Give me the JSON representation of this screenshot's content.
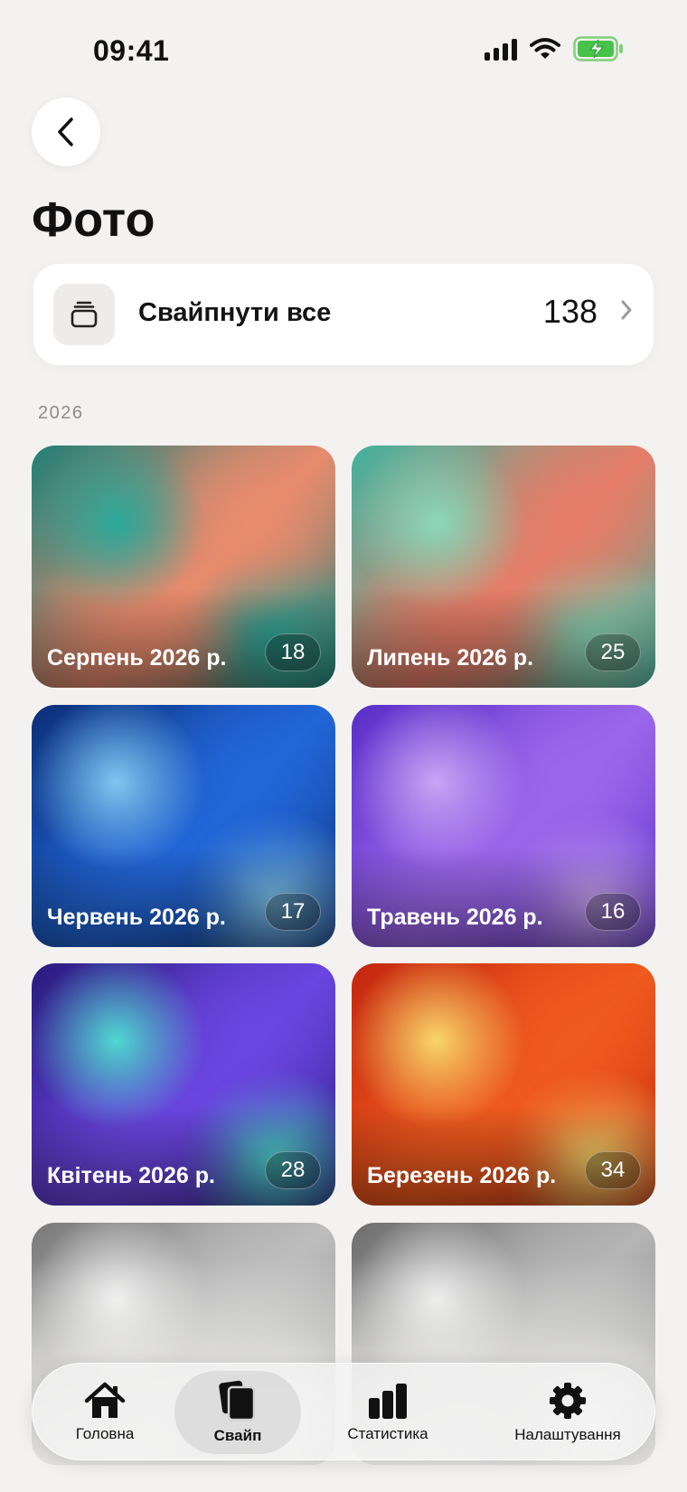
{
  "status_bar": {
    "time": "09:41"
  },
  "header": {
    "title": "Фото"
  },
  "swipe_all": {
    "label": "Свайпнути все",
    "count": "138"
  },
  "sections": [
    {
      "year": "2026",
      "months": [
        {
          "label": "Серпень 2026 р.",
          "count": "18",
          "palette": [
            "#1f7f78",
            "#e98b6d",
            "#2aa99a"
          ]
        },
        {
          "label": "Липень 2026 р.",
          "count": "25",
          "palette": [
            "#3fb3a0",
            "#e67d68",
            "#8ad8b8"
          ]
        },
        {
          "label": "Червень 2026 р.",
          "count": "17",
          "palette": [
            "#0b2f78",
            "#2266d8",
            "#7fc6f0"
          ]
        },
        {
          "label": "Травень 2026 р.",
          "count": "16",
          "palette": [
            "#5a2ec8",
            "#9b66ea",
            "#c9a4f4"
          ]
        },
        {
          "label": "Квітень 2026 р.",
          "count": "28",
          "palette": [
            "#2a1b7e",
            "#6a45e0",
            "#4fd8d0"
          ]
        },
        {
          "label": "Березень 2026 р.",
          "count": "34",
          "palette": [
            "#c4270f",
            "#ef5a1e",
            "#f8d66a"
          ]
        },
        {
          "label": "",
          "count": "",
          "palette": [
            "#7a7a7a",
            "#bdbdbd",
            "#efefef"
          ]
        },
        {
          "label": "",
          "count": "",
          "palette": [
            "#6e6e6e",
            "#b5b5b5",
            "#ececec"
          ]
        }
      ]
    }
  ],
  "tabbar": {
    "tabs": [
      {
        "label": "Головна",
        "icon": "house-icon",
        "active": false
      },
      {
        "label": "Свайп",
        "icon": "cards-icon",
        "active": true
      },
      {
        "label": "Статистика",
        "icon": "bar-chart-icon",
        "active": false
      },
      {
        "label": "Налаштування",
        "icon": "gear-icon",
        "active": false
      }
    ]
  }
}
